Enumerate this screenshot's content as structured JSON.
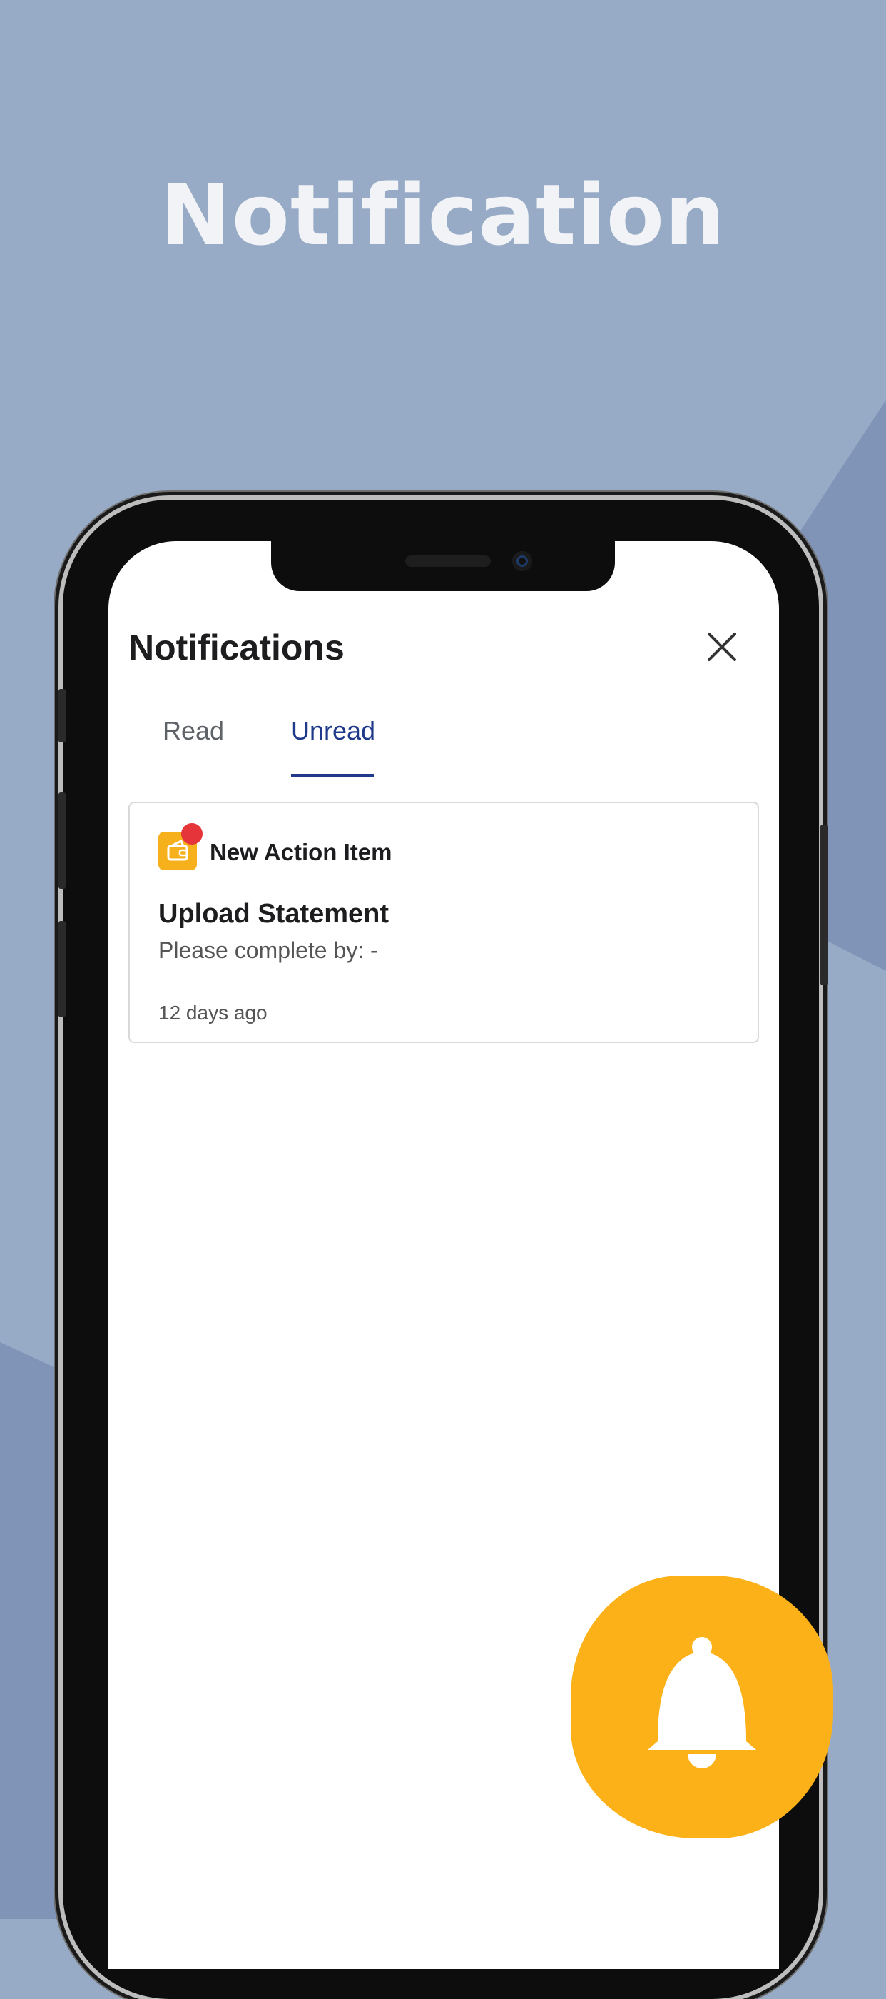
{
  "colors": {
    "background": "#98abc6",
    "background_shape": "#8094b7",
    "accent_blue": "#1f3a8a",
    "accent_yellow": "#fbb117",
    "badge_red": "#e5343a"
  },
  "promo": {
    "headline": "Notification"
  },
  "panel": {
    "title": "Notifications",
    "close_icon": "close-icon",
    "tabs": [
      {
        "label": "Read",
        "selected": false
      },
      {
        "label": "Unread",
        "selected": true
      }
    ]
  },
  "notifications": [
    {
      "icon": "wallet-icon",
      "unread_badge": true,
      "kind": "New Action Item",
      "title": "Upload Statement",
      "subtitle": "Please complete by: -",
      "time": "12 days ago"
    }
  ],
  "fab": {
    "icon": "bell-icon"
  }
}
